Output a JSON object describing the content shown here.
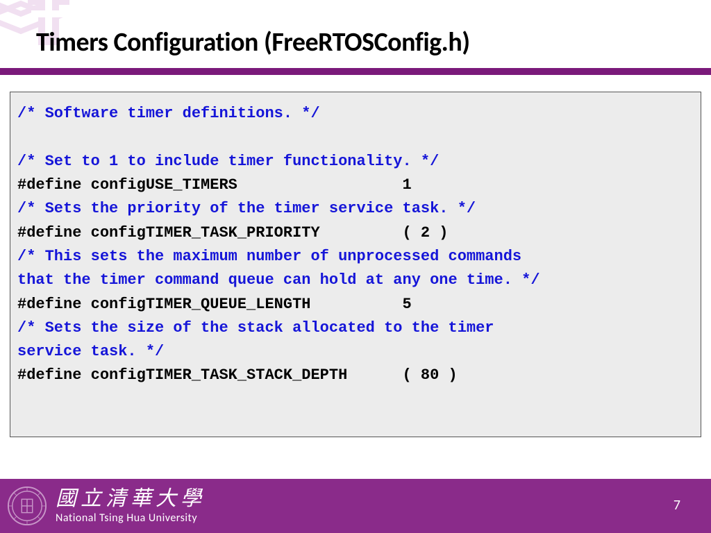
{
  "slide": {
    "title": "Timers Configuration (FreeRTOSConfig.h)",
    "page_number": "7"
  },
  "code": {
    "c0": "/* Software timer definitions. */",
    "blank": "",
    "c1": "/* Set to 1 to include timer functionality. */",
    "d1": "#define configUSE_TIMERS                  1",
    "c2": "/* Sets the priority of the timer service task. */",
    "d2": "#define configTIMER_TASK_PRIORITY         ( 2 )",
    "c3a": "/* This sets the maximum number of unprocessed commands",
    "c3b": "that the timer command queue can hold at any one time. */",
    "d3": "#define configTIMER_QUEUE_LENGTH          5",
    "c4a": "/* Sets the size of the stack allocated to the timer",
    "c4b": "service task. */",
    "d4": "#define configTIMER_TASK_STACK_DEPTH      ( 80 )"
  },
  "footer": {
    "chinese": "國立清華大學",
    "english": "National Tsing Hua University"
  },
  "colors": {
    "purple": "#8a2b8a",
    "comment_blue": "#1515d8",
    "code_bg": "#ececec"
  }
}
